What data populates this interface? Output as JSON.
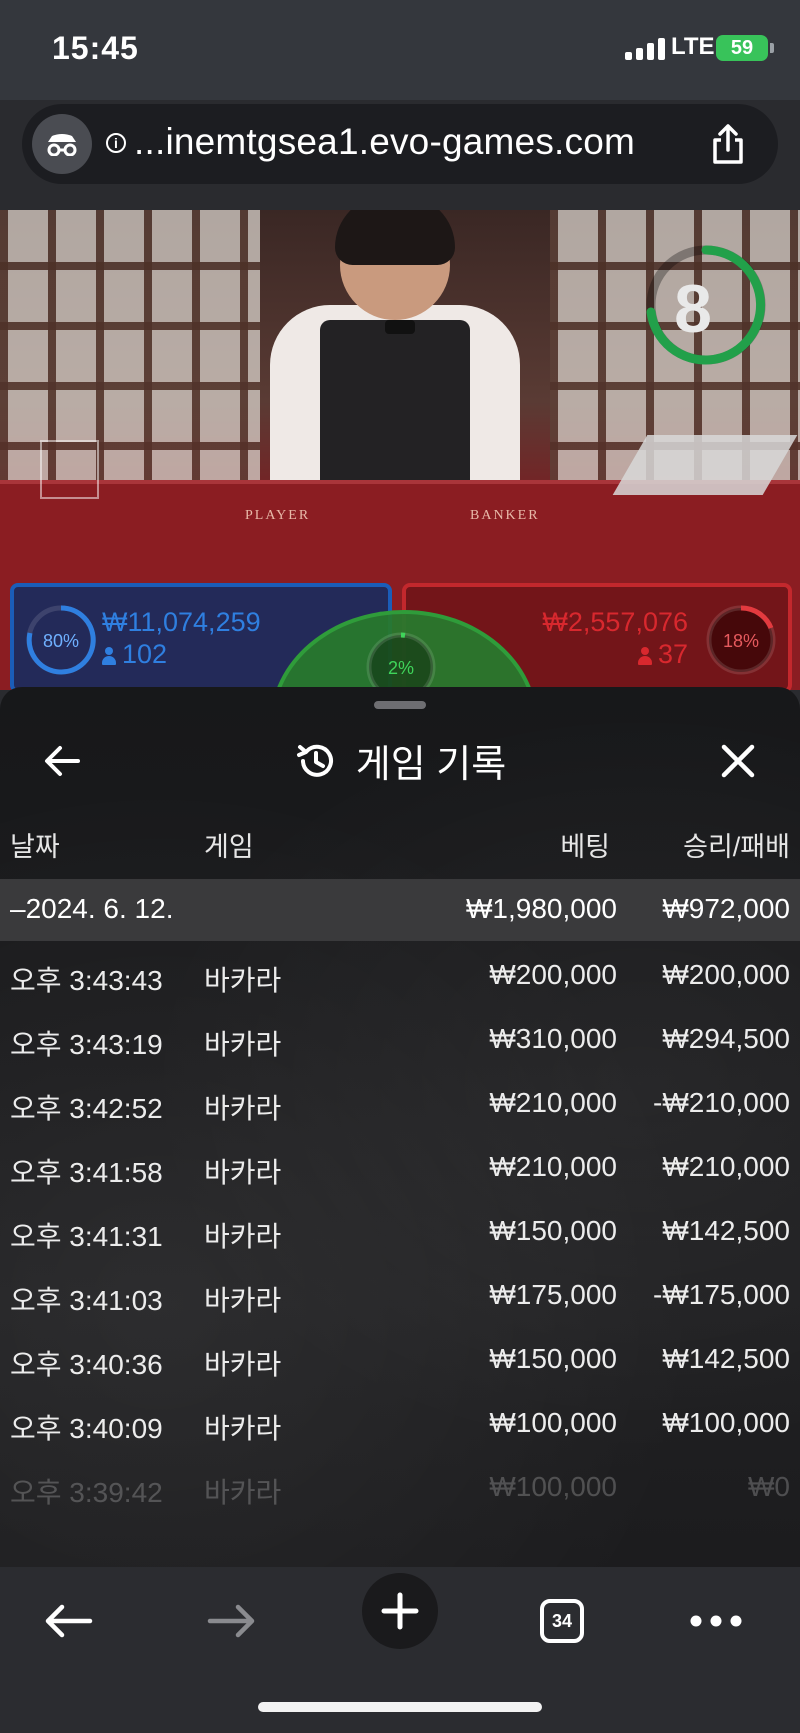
{
  "status_bar": {
    "time": "15:45",
    "network": "LTE",
    "battery": "59"
  },
  "browser": {
    "url": "...inemtgsea1.evo-games.com"
  },
  "video": {
    "timer": "8",
    "table_player": "PLAYER",
    "table_banker": "BANKER"
  },
  "bets": {
    "player": {
      "percent": "80%",
      "amount": "₩11,074,259",
      "count": "102"
    },
    "banker": {
      "percent": "18%",
      "amount": "₩2,557,076",
      "count": "37"
    },
    "tie": {
      "percent": "2%"
    }
  },
  "history": {
    "title": "게임 기록",
    "columns": {
      "date": "날짜",
      "game": "게임",
      "bet": "베팅",
      "win_loss": "승리/패배"
    },
    "summary": {
      "date": "–2024. 6. 12.",
      "bet": "₩1,980,000",
      "win_loss": "₩972,000"
    },
    "rows": [
      {
        "time": "오후 3:43:43",
        "game": "바카라",
        "bet": "₩200,000",
        "result": "₩200,000"
      },
      {
        "time": "오후 3:43:19",
        "game": "바카라",
        "bet": "₩310,000",
        "result": "₩294,500"
      },
      {
        "time": "오후 3:42:52",
        "game": "바카라",
        "bet": "₩210,000",
        "result": "-₩210,000"
      },
      {
        "time": "오후 3:41:58",
        "game": "바카라",
        "bet": "₩210,000",
        "result": "₩210,000"
      },
      {
        "time": "오후 3:41:31",
        "game": "바카라",
        "bet": "₩150,000",
        "result": "₩142,500"
      },
      {
        "time": "오후 3:41:03",
        "game": "바카라",
        "bet": "₩175,000",
        "result": "-₩175,000"
      },
      {
        "time": "오후 3:40:36",
        "game": "바카라",
        "bet": "₩150,000",
        "result": "₩142,500"
      },
      {
        "time": "오후 3:40:09",
        "game": "바카라",
        "bet": "₩100,000",
        "result": "₩100,000"
      },
      {
        "time": "오후 3:39:42",
        "game": "바카라",
        "bet": "₩100,000",
        "result": "₩0"
      }
    ]
  },
  "toolbar": {
    "tab_count": "34"
  },
  "colors": {
    "player_blue": "#1b5db8",
    "banker_red": "#c3282d",
    "tie_green": "#2f9c3a",
    "timer_green": "#22a04a"
  }
}
